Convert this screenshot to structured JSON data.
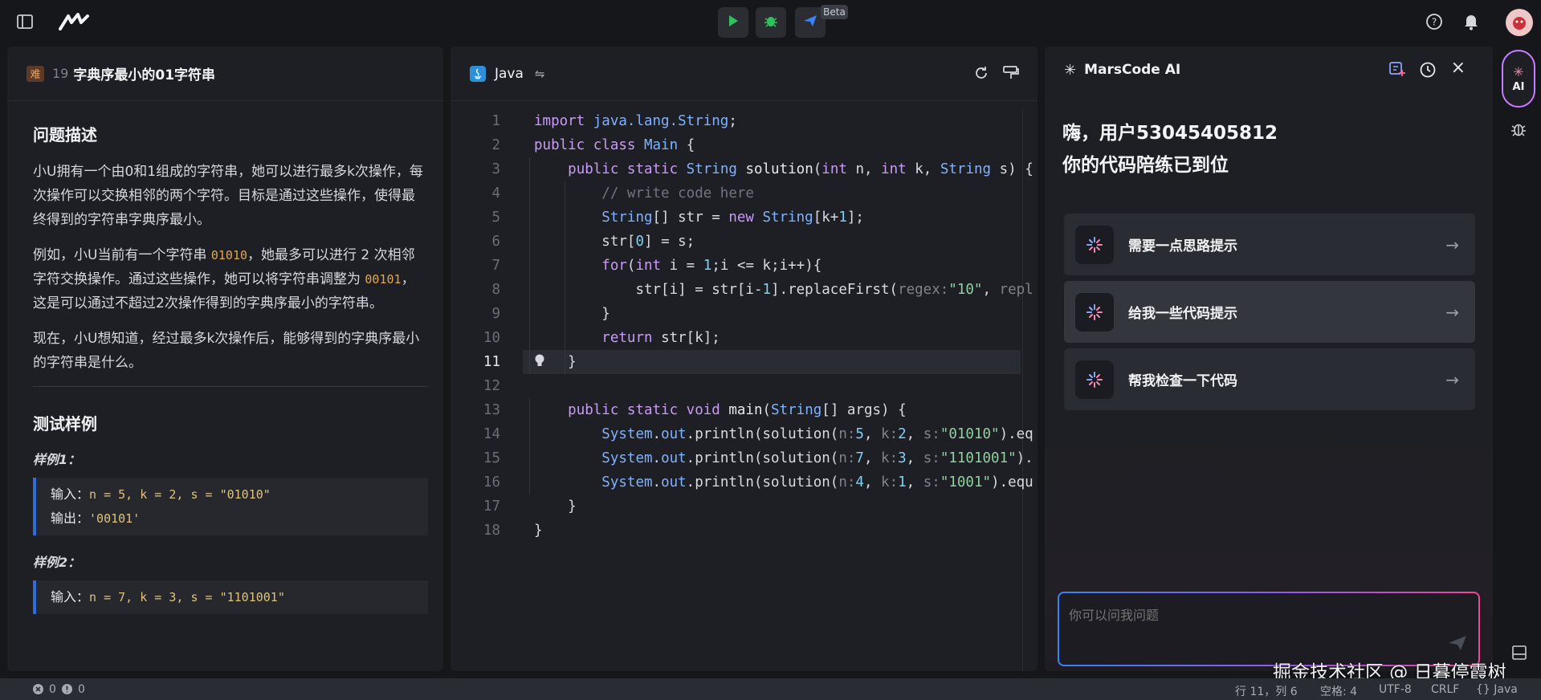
{
  "topbar": {
    "beta_label": "Beta",
    "icons": [
      "sidebar-toggle-icon",
      "marscode-logo",
      "run-icon",
      "debug-icon",
      "submit-icon",
      "help-icon",
      "bell-icon",
      "avatar"
    ]
  },
  "problem": {
    "difficulty": "难",
    "number": "19",
    "title": "字典序最小的01字符串",
    "section_desc": "问题描述",
    "para1": "小U拥有一个由0和1组成的字符串，她可以进行最多k次操作，每次操作可以交换相邻的两个字符。目标是通过这些操作，使得最终得到的字符串字典序最小。",
    "para2_a": "例如，小U当前有一个字符串 ",
    "para2_code1": "01010",
    "para2_b": "，她最多可以进行 2 次相邻字符交换操作。通过这些操作，她可以将字符串调整为 ",
    "para2_code2": "00101",
    "para2_c": "，这是可以通过不超过2次操作得到的字典序最小的字符串。",
    "para3": "现在，小U想知道，经过最多k次操作后，能够得到的字典序最小的字符串是什么。",
    "section_tests": "测试样例",
    "sample1_title": "样例1：",
    "sample1_in_label": "输入：",
    "sample1_in": "n = 5, k = 2, s = \"01010\"",
    "sample1_out_label": "输出：",
    "sample1_out": "'00101'",
    "sample2_title": "样例2：",
    "sample2_in_label": "输入：",
    "sample2_in": "n = 7, k = 3, s = \"1101001\""
  },
  "editor": {
    "language": "Java",
    "active_line": 11,
    "line_numbers": [
      "1",
      "2",
      "3",
      "4",
      "5",
      "6",
      "7",
      "8",
      "9",
      "10",
      "11",
      "12",
      "13",
      "14",
      "15",
      "16",
      "17",
      "18"
    ]
  },
  "ai": {
    "title": "MarsCode AI",
    "greeting_line1": "嗨，用户53045405812",
    "greeting_line2": "你的代码陪练已到位",
    "suggestions": [
      {
        "label": "需要一点思路提示"
      },
      {
        "label": "给我一些代码提示"
      },
      {
        "label": "帮我检查一下代码"
      }
    ],
    "input_placeholder": "你可以问我问题",
    "side_ai_label": "AI"
  },
  "status": {
    "errors": "0",
    "warnings": "0",
    "position": "行 11，列 6",
    "spaces": "空格: 4",
    "encoding": "UTF-8",
    "eol": "CRLF",
    "lang": "{} Java"
  },
  "watermark": "掘金技术社区 @ 日暮停霞树",
  "colors": {
    "accent": "#2d6fd6",
    "run": "#2fbf5b",
    "bg": "#16171b",
    "panel": "#1e1f24"
  }
}
